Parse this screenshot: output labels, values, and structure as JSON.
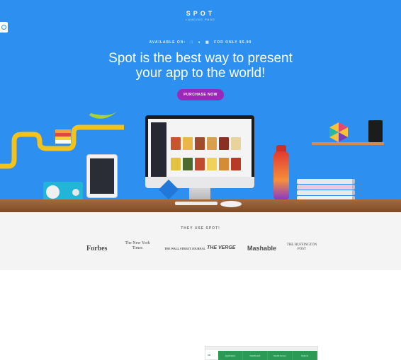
{
  "brand": {
    "name": "SPOT",
    "tagline": "LANDING PAGE"
  },
  "hero": {
    "available_label": "AVAILABLE ON:",
    "platform_icons": [
      "apple-icon",
      "android-icon",
      "windows-icon"
    ],
    "price_label": "FOR ONLY $5.99",
    "headline_line1": "Spot is the best way to present",
    "headline_line2": "your app to the world!",
    "cta_label": "PURCHASE NOW",
    "bg_color": "#2d8ff0",
    "cta_color": "#9b28b8"
  },
  "partners": {
    "title": "THEY USE SPOT!",
    "logos": [
      "Forbes",
      "The New York Times",
      "THE WALL STREET JOURNAL",
      "THE VERGE",
      "Mashable",
      "THE HUFFINGTON POST"
    ]
  },
  "preview": {
    "brand": "XD",
    "nav": [
      "Application",
      "Dashboard",
      "Media Server",
      "Options"
    ]
  }
}
